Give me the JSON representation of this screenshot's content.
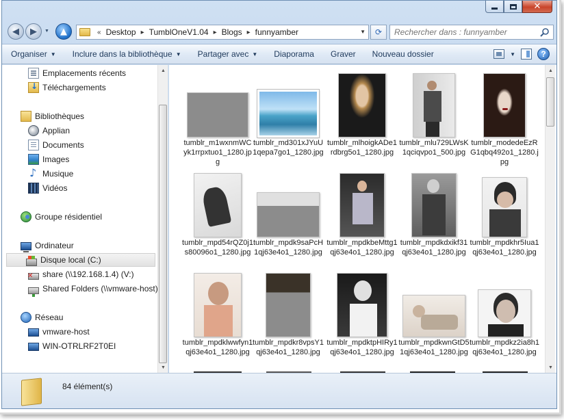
{
  "window": {
    "caption_buttons": {
      "minimize": "minimize-icon",
      "maximize": "maximize-icon",
      "close": "close-icon"
    }
  },
  "address": {
    "prefix": "«",
    "crumbs": [
      "Desktop",
      "TumblOneV1.04",
      "Blogs",
      "funnyamber"
    ],
    "separator": "▸"
  },
  "search": {
    "placeholder": "Rechercher dans : funnyamber"
  },
  "toolbar": {
    "organize": "Organiser",
    "include": "Inclure dans la bibliothèque",
    "share": "Partager avec",
    "slideshow": "Diaporama",
    "burn": "Graver",
    "new_folder": "Nouveau dossier"
  },
  "nav": {
    "favorites": [
      "Emplacements récents",
      "Téléchargements"
    ],
    "libraries_label": "Bibliothèques",
    "libraries": [
      "Applian",
      "Documents",
      "Images",
      "Musique",
      "Vidéos"
    ],
    "homegroup": "Groupe résidentiel",
    "computer_label": "Ordinateur",
    "drives": [
      "Disque local (C:)",
      "share (\\\\192.168.1.4) (V:)",
      "Shared Folders (\\\\vmware-host)"
    ],
    "network_label": "Réseau",
    "network_items": [
      "vmware-host",
      "WIN-OTRLRF2T0EI"
    ]
  },
  "files": [
    "tumblr_m1wxnmWCyk1rrpxtuo1_1280.jpg",
    "tumblr_md301xJYuU1qepa7go1_1280.jpg",
    "tumblr_mlhoigkADe1rdbrg5o1_1280.jpg",
    "tumblr_mlu729LWsK1qciqvpo1_500.jpg",
    "tumblr_modedeEzRG1qbq492o1_1280.jpg",
    "tumblr_mpd54rQZ0j1s80096o1_1280.jpg",
    "tumblr_mpdk9saPcH1qj63e4o1_1280.jpg",
    "tumblr_mpdkbeMttg1qj63e4o1_1280.jpg",
    "tumblr_mpdkdxikf31qj63e4o1_1280.jpg",
    "tumblr_mpdkhr5Iua1qj63e4o1_1280.jpg",
    "tumblr_mpdklwwfyn1qj63e4o1_1280.jpg",
    "tumblr_mpdkr8vpsY1qj63e4o1_1280.jpg",
    "tumblr_mpdktpHIRy1qj63e4o1_1280.jpg",
    "tumblr_mpdkwnGtD51qj63e4o1_1280.jpg",
    "tumblr_mpdkz2ia8h1qj63e4o1_1280.jpg"
  ],
  "status": {
    "count": "84 élément(s)"
  },
  "colors": {
    "accent": "#1e5fb0",
    "chrome": "#bed3ea",
    "command_text": "#1e395b"
  }
}
